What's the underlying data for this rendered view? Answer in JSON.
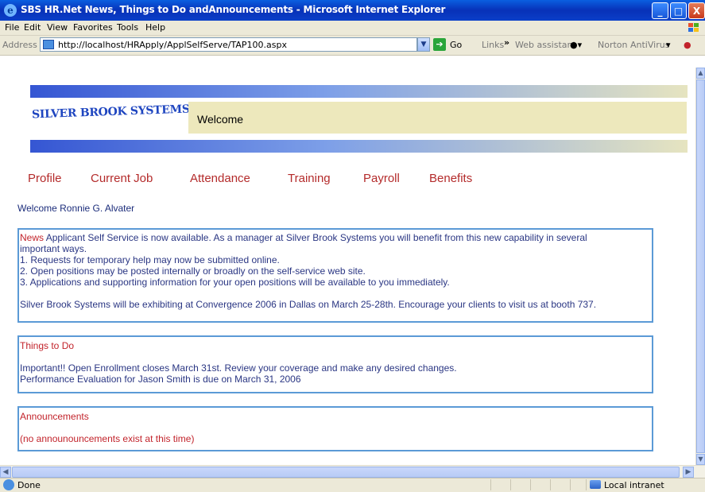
{
  "window": {
    "title": "SBS HR.Net News, Things to Do andAnnouncements - Microsoft Internet Explorer",
    "min_label": "_",
    "max_label": "□",
    "close_label": "X"
  },
  "menu": [
    "File",
    "Edit",
    "View",
    "Favorites",
    "Tools",
    "Help"
  ],
  "address": {
    "label": "Address",
    "url": "http://localhost/HRApply/ApplSelfServe/TAP100.aspx",
    "go_label": "Go",
    "links_label": "Links",
    "chevron": "»",
    "web_assistant": "Web assistant",
    "norton": "Norton AntiVirus"
  },
  "page": {
    "logo_text": "SILVER BROOK SYSTEMS",
    "welcome_label": "Welcome",
    "nav": [
      "Profile",
      "Current Job",
      "Attendance",
      "Training",
      "Payroll",
      "Benefits"
    ],
    "greeting": "Welcome Ronnie G. Alvater",
    "news": {
      "heading": "News",
      "intro": " Applicant Self Service is now available. As a manager at Silver Brook Systems you will benefit from this new capability in several",
      "intro2": "important ways.",
      "items": [
        "1. Requests for temporary help may now be submitted online.",
        "2. Open positions may be posted internally or broadly on the self-service web site.",
        "3. Applications and supporting information for your open positions will be available to you immediately."
      ],
      "footer": "Silver Brook Systems will be exhibiting at Convergence 2006 in Dallas on March 25-28th. Encourage your clients to visit us at booth 737."
    },
    "todo": {
      "heading": "Things to Do",
      "items": [
        "Important!! Open Enrollment closes March 31st. Review your coverage and make any desired changes.",
        "Performance Evaluation for Jason Smith is due on March 31, 2006"
      ]
    },
    "announcements": {
      "heading": "Announcements",
      "empty": "(no announouncements exist at this time)"
    }
  },
  "status": {
    "text": "Done",
    "zone": "Local intranet"
  },
  "colors": {
    "nav": "#b42b2b",
    "box_border": "#5b9ad6",
    "welcome_bg": "#ede8bc",
    "text_blue": "#2a3683"
  }
}
